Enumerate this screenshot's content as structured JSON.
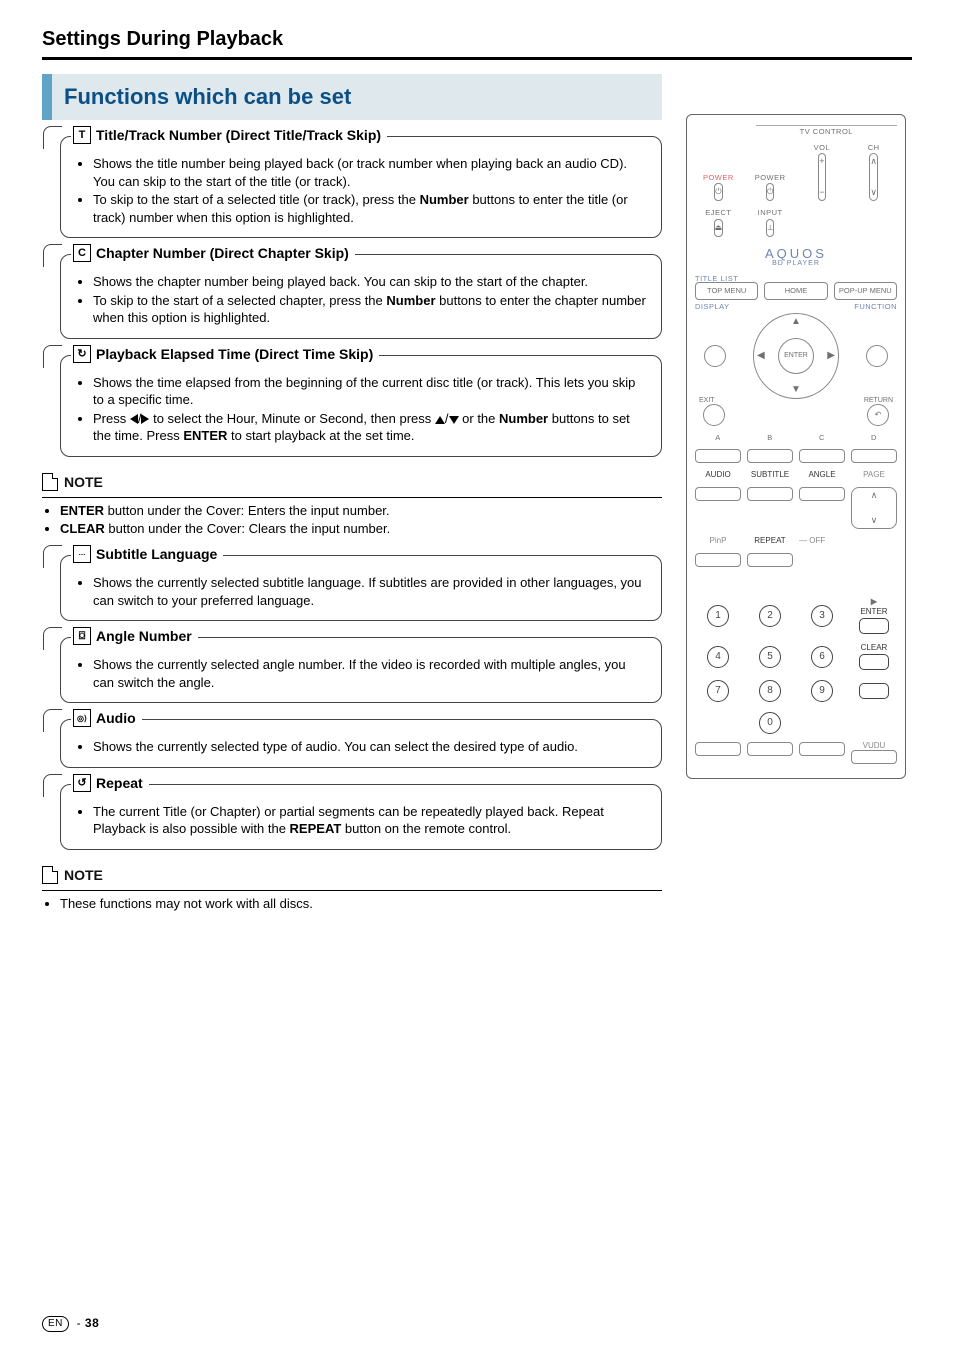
{
  "page_heading": "Settings During Playback",
  "section_title": "Functions which can be set",
  "functions": {
    "title_track": {
      "icon": "T",
      "heading": "Title/Track Number (Direct Title/Track Skip)",
      "bullets": [
        "Shows the title number being played back (or track number when playing back an audio CD). You can skip to the start of the title (or track).",
        "To skip to the start of a selected title (or track), press the <b>Number</b> buttons to enter the title (or track) number when this option is highlighted."
      ]
    },
    "chapter": {
      "icon": "C",
      "heading": "Chapter Number (Direct Chapter Skip)",
      "bullets": [
        "Shows the chapter number being played back. You can skip to the start of the chapter.",
        "To skip to the start of a selected chapter, press the <b>Number</b> buttons to enter the chapter number when this option is highlighted."
      ]
    },
    "elapsed": {
      "icon": "↻",
      "heading": "Playback Elapsed Time (Direct Time Skip)",
      "bullets": [
        "Shows the time elapsed from the beginning of the current disc title (or track). This lets you skip to a specific time.",
        "Press <span class='glyph-tri tri-left'></span>/<span class='glyph-tri tri-right'></span> to select the Hour, Minute or Second, then press <span class='glyph-tri tri-up'></span>/<span class='glyph-tri tri-down'></span> or the <b>Number</b> buttons to set the time. Press <b>ENTER</b> to start playback at the set time."
      ]
    },
    "subtitle": {
      "icon": "....",
      "heading": "Subtitle Language",
      "bullets": [
        "Shows the currently selected subtitle language. If subtitles are provided in other languages, you can switch to your preferred language."
      ]
    },
    "angle": {
      "icon": "⌼",
      "heading": "Angle Number",
      "bullets": [
        "Shows the currently selected angle number. If the video is recorded with multiple angles, you can switch the angle."
      ]
    },
    "audio": {
      "icon": "◎⟩",
      "heading": "Audio",
      "bullets": [
        "Shows the currently selected type of audio. You can select the desired type of audio."
      ]
    },
    "repeat": {
      "icon": "↺",
      "heading": "Repeat",
      "bullets": [
        "The current Title (or Chapter) or partial segments can be repeatedly played back. Repeat Playback is also possible with the <b>REPEAT</b> button on the remote control."
      ]
    }
  },
  "notes": {
    "one": {
      "label": "NOTE",
      "bullets": [
        "<b>ENTER</b> button under the Cover: Enters the input number.",
        "<b>CLEAR</b> button under the Cover: Clears the input number."
      ]
    },
    "two": {
      "label": "NOTE",
      "bullets": [
        "These functions may not work with all discs."
      ]
    }
  },
  "remote": {
    "tv_control": "TV CONTROL",
    "power_left": "POWER",
    "power": "POWER",
    "vol": "VOL",
    "ch": "CH",
    "eject": "EJECT",
    "input": "INPUT",
    "brand": "AQUOS",
    "brand_sub": "BD PLAYER",
    "title_list": "TITLE LIST",
    "top_menu": "TOP MENU",
    "home": "HOME",
    "popup": "POP-UP MENU",
    "display": "DISPLAY",
    "function": "FUNCTION",
    "enter": "ENTER",
    "exit": "EXIT",
    "rtn": "RETURN",
    "abcd": [
      "A",
      "B",
      "C",
      "D"
    ],
    "row_labels": [
      "AUDIO",
      "SUBTITLE",
      "ANGLE",
      "PAGE"
    ],
    "pinp": "PinP",
    "repeat": "REPEAT",
    "off": "OFF",
    "enter2": "ENTER",
    "clear": "CLEAR",
    "vudu": "VUDU"
  },
  "footer": {
    "lang": "EN",
    "page": "38"
  }
}
